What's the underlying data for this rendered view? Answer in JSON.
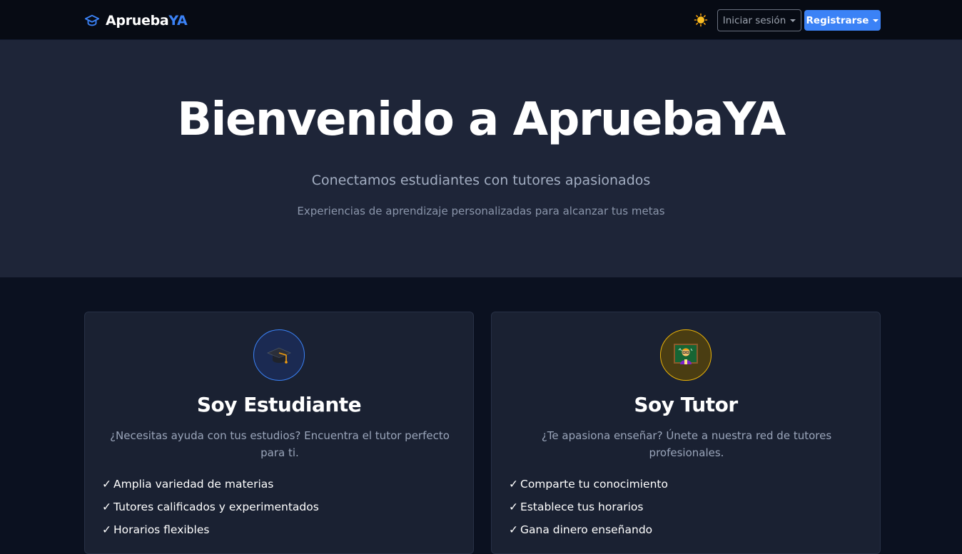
{
  "colors": {
    "accent": "#3b82f6",
    "tutor_accent": "#eab308",
    "background": "#0b1120",
    "hero_background": "#1e2538"
  },
  "navbar": {
    "brand_main": "Aprueba",
    "brand_accent": "YA",
    "brand_icon": "graduation-cap-icon",
    "theme_toggle_icon": "sun-icon",
    "login_label": "Iniciar sesión",
    "register_label": "Registrarse"
  },
  "hero": {
    "title": "Bienvenido a ApruebaYA",
    "subtitle": "Conectamos estudiantes con tutores apasionados",
    "tagline": "Experiencias de aprendizaje personalizadas para alcanzar tus metas"
  },
  "cards": [
    {
      "icon": "graduation-cap-icon",
      "title": "Soy Estudiante",
      "description": "¿Necesitas ayuda con tus estudios? Encuentra el tutor perfecto para ti.",
      "check_mark": "✓",
      "features": [
        "Amplia variedad de materias",
        "Tutores calificados y experimentados",
        "Horarios flexibles"
      ]
    },
    {
      "icon": "teacher-icon",
      "title": "Soy Tutor",
      "description": "¿Te apasiona enseñar? Únete a nuestra red de tutores profesionales.",
      "check_mark": "✓",
      "features": [
        "Comparte tu conocimiento",
        "Establece tus horarios",
        "Gana dinero enseñando"
      ]
    }
  ]
}
